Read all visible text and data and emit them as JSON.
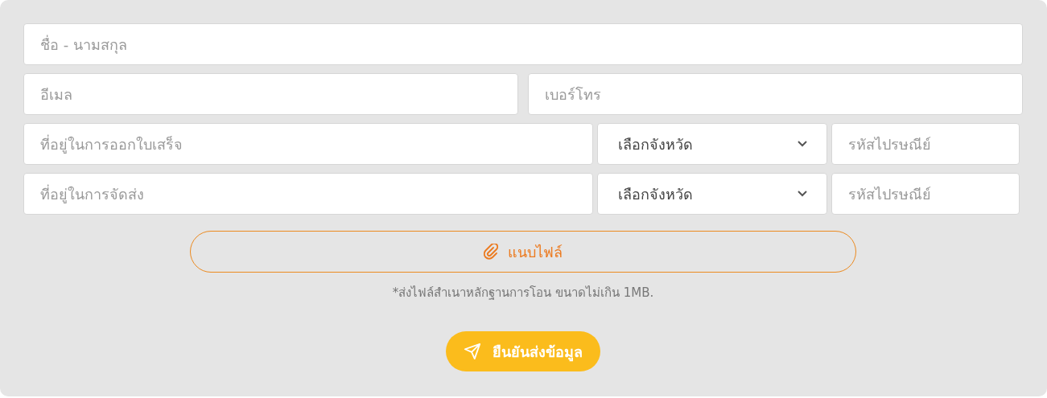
{
  "rows": [
    {
      "fields": [
        {
          "kind": "input",
          "placeholder": "ชื่อ - นามสกุล"
        }
      ]
    },
    {
      "fields": [
        {
          "kind": "input",
          "placeholder": "อีเมล"
        },
        {
          "kind": "input",
          "placeholder": "เบอร์โทร"
        }
      ]
    },
    {
      "fields": [
        {
          "kind": "input",
          "placeholder": "ที่อยู่ในการออกใบเสร็จ"
        },
        {
          "kind": "select",
          "value": "เลือกจังหวัด"
        },
        {
          "kind": "zip",
          "placeholder": "รหัสไปรษณีย์"
        }
      ]
    },
    {
      "fields": [
        {
          "kind": "input",
          "placeholder": "ที่อยู่ในการจัดส่ง"
        },
        {
          "kind": "select",
          "value": "เลือกจังหวัด"
        },
        {
          "kind": "zip",
          "placeholder": "รหัสไปรษณีย์"
        }
      ]
    }
  ],
  "attach_button": "แนบไฟล์",
  "note": "*ส่งไฟล์สำเนาหลักฐานการโอน ขนาดไม่เกิน 1MB.",
  "submit_button": "ยืนยันส่งข้อมูล"
}
